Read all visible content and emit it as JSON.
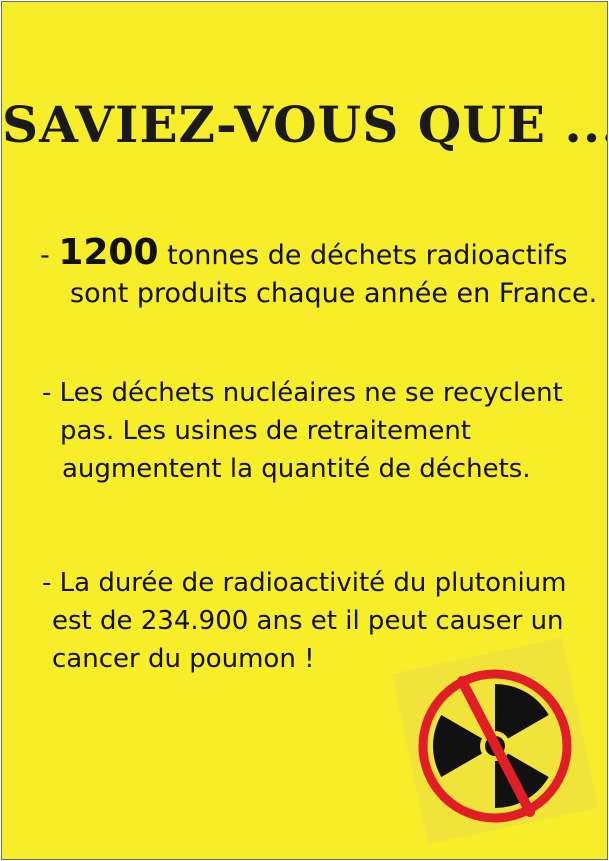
{
  "poster": {
    "background": "#f7ed29",
    "title": "SAVIEZ-VOUS QUE ...",
    "items": [
      {
        "bullet": "- ",
        "highlight": "1200",
        "lines": [
          " tonnes de déchets radioactifs",
          "sont produits chaque année en France."
        ]
      },
      {
        "lines": [
          "- Les déchets nucléaires ne se recyclent",
          "pas. Les usines de retraitement",
          "augmentent la quantité de déchets."
        ]
      },
      {
        "lines": [
          "- La durée de radioactivité du plutonium",
          "est de 234.900 ans et il peut causer un",
          "cancer du poumon !"
        ]
      }
    ]
  },
  "sign": {
    "icon": "no-nuclear-icon",
    "circle_color": "#e11d25",
    "trefoil_color": "#111111",
    "tile_color": "#f0e43a"
  }
}
